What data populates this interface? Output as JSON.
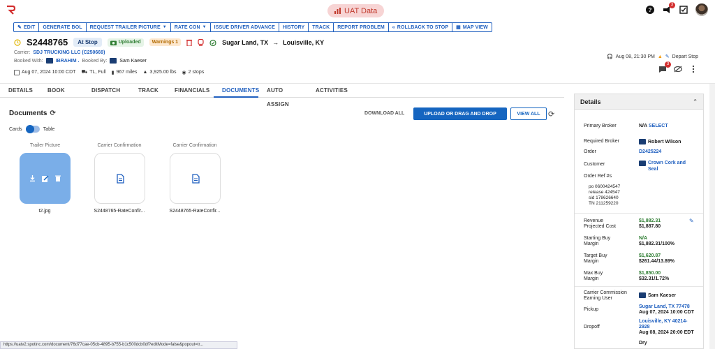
{
  "header": {
    "environment": "UAT Data",
    "notification_count": "3",
    "icons": [
      "logo-icon",
      "help-icon",
      "megaphone-icon",
      "checklist-icon",
      "avatar"
    ]
  },
  "toolbar": {
    "edit": "EDIT",
    "generate_bol": "GENERATE BOL",
    "request_trailer_picture": "REQUEST TRAILER PICTURE",
    "rate_con": "RATE CON",
    "issue_driver_advance": "ISSUE DRIVER ADVANCE",
    "history": "HISTORY",
    "track": "TRACK",
    "report_problem": "REPORT PROBLEM",
    "rollback": "ROLLBACK TO STOP",
    "map_view": "MAP VIEW"
  },
  "order": {
    "number": "S2448765",
    "status": "At Stop",
    "uploaded": "Uploaded",
    "warnings": "Warnings 1",
    "origin": "Sugar Land, TX",
    "destination": "Louisville, KY",
    "carrier_label": "Carrier:",
    "carrier": "SDJ TRUCKING LLC (C250669)",
    "booked_with_label": "Booked With:",
    "booked_with": "IBRAHIM .",
    "booked_by_label": "Booked By:",
    "booked_by": "Sam Kaeser",
    "date": "Aug 07, 2024 10:00 CDT",
    "mode": "TL, Full",
    "miles": "967 miles",
    "weight": "3,925.00 lbs",
    "stops": "2 stops",
    "last_update": "Aug 08, 21:30 PM",
    "depart_stop": "Depart Stop",
    "message_count": "3"
  },
  "tabs": [
    "DETAILS",
    "BOOK",
    "DISPATCH",
    "TRACK",
    "FINANCIALS",
    "DOCUMENTS",
    "AUTO ASSIGN",
    "ACTIVITIES"
  ],
  "documents": {
    "title": "Documents",
    "download_all": "DOWNLOAD ALL",
    "upload": "UPLOAD OR DRAG AND DROP",
    "view_all": "VIEW ALL",
    "toggle_left": "Cards",
    "toggle_right": "Table",
    "cards": [
      {
        "type": "Trailer Picture",
        "name": "t2.jpg"
      },
      {
        "type": "Carrier Confirmation",
        "name": "S2448765-RateConfir..."
      },
      {
        "type": "Carrier Confirmation",
        "name": "S2448765-RateConfir..."
      }
    ]
  },
  "details": {
    "title": "Details",
    "primary_broker_label": "Primary Broker",
    "primary_broker": "N/A",
    "select": "SELECT",
    "required_broker_label": "Required Broker",
    "required_broker": "Robert Wilson",
    "order_label": "Order",
    "order": "D2425224",
    "customer_label": "Customer",
    "customer_line1": "Crown Cork and",
    "customer_line2": "Seal",
    "order_ref_label": "Order Ref #s",
    "refs": [
      "po  0600424547",
      "release  424547",
      "sid  178626640",
      "TN  211259220"
    ],
    "revenue_label": "Revenue",
    "revenue": "$1,882.31",
    "projected_cost_label": "Projected Cost",
    "projected_cost": "$1,887.80",
    "starting_buy_label": "Starting Buy",
    "starting_buy": "N/A",
    "margin_label": "Margin",
    "starting_margin": "$1,882.31/100%",
    "target_buy_label": "Target Buy",
    "target_buy": "$1,620.87",
    "target_margin": "$261.44/13.89%",
    "max_buy_label": "Max Buy",
    "max_buy": "$1,850.00",
    "max_margin": "$32.31/1.72%",
    "carrier_commission_label": "Carrier Commission",
    "earning_user_label": "Earning User",
    "earning_user": "Sam Kaeser",
    "pickup_label": "Pickup",
    "pickup_place": "Sugar Land, TX 77478",
    "pickup_time": "Aug 07, 2024 10:00 CDT",
    "dropoff_label": "Dropoff",
    "dropoff_place": "Louisville, KY 40214-",
    "dropoff_place2": "2928",
    "dropoff_time": "Aug 08, 2024 20:00 EDT",
    "dry": "Dry"
  },
  "status_url": "https://uatv2.spotinc.com/document/76d77cae-05cb-4895-b755-b1c500dcb0df?editMode=false&popout=tr..."
}
